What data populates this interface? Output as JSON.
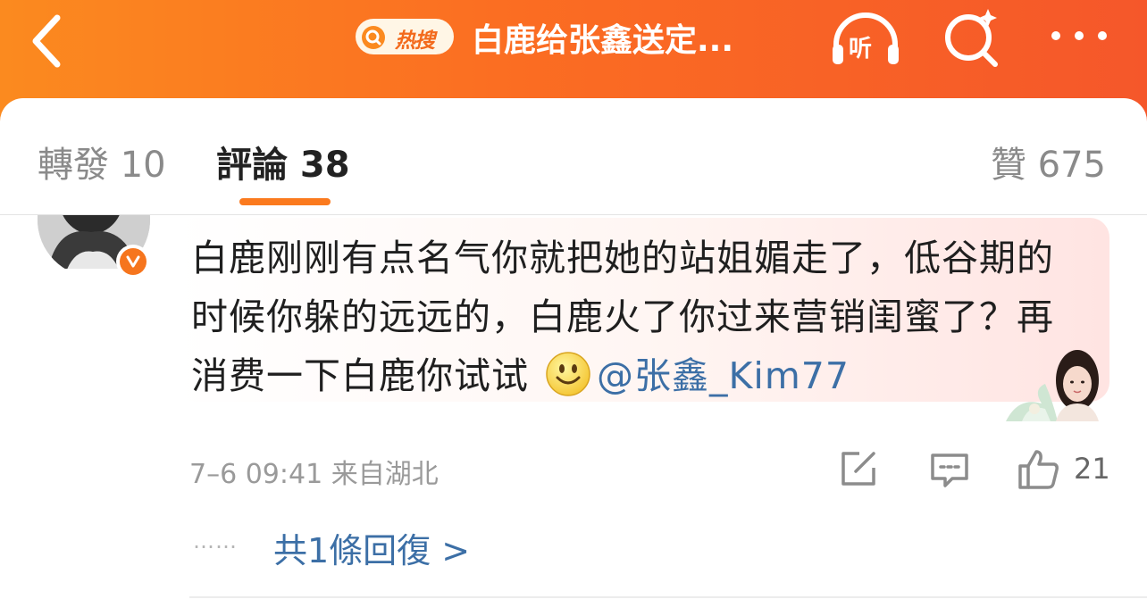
{
  "header": {
    "hot_search_label": "热搜",
    "topic_title": "白鹿给张鑫送定...",
    "listen_label": "听",
    "icons": {
      "back": "chevron-left-icon",
      "hot_search": "search-icon",
      "listen": "headphones-icon",
      "search": "search-sparkle-icon",
      "more": "more-dots-icon"
    },
    "colors": {
      "bar_start": "#fb8a1f",
      "bar_end": "#f5572a"
    }
  },
  "tabs": {
    "repost": "轉發 10",
    "comments": "評論 38",
    "likes": "贊 675",
    "active_color": "#fb7a1e"
  },
  "comment": {
    "text": "白鹿刚刚有点名气你就把她的站姐媚走了，低谷期的时候你躲的远远的，白鹿火了你过来营销闺蜜了？再消费一下白鹿你试试",
    "mention": "@张鑫_Kim77",
    "emoji": "smiley-icon",
    "verified_badge": "v-badge-icon",
    "meta": "7–6 09:41 来自湖北",
    "like_count": "21",
    "reply_dots": "……",
    "reply_link": "共1條回復 >",
    "mention_color": "#3c6fa6"
  }
}
